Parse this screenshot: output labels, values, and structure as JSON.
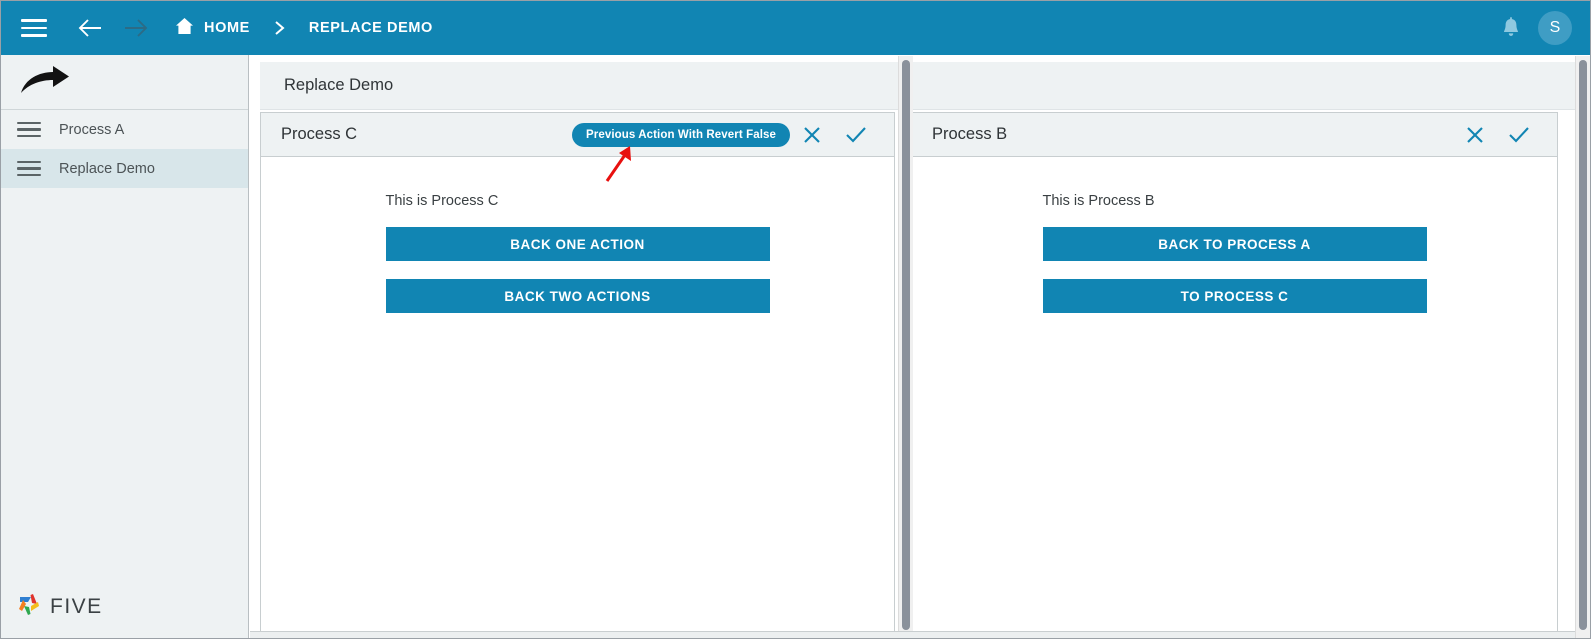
{
  "topbar": {
    "menu_icon": "hamburger-icon",
    "back_icon": "arrow-left-icon",
    "forward_icon": "arrow-right-icon",
    "home_icon": "home-icon",
    "home_label": "HOME",
    "separator": "chevron-right-icon",
    "breadcrumb_current": "REPLACE DEMO",
    "bell_icon": "bell-icon",
    "avatar_initial": "S",
    "background_color": "#1185b3"
  },
  "sidebar": {
    "logo_icon": "curved-arrow-icon",
    "items": [
      {
        "label": "Process A",
        "icon": "hamburger-icon",
        "selected": false
      },
      {
        "label": "Replace Demo",
        "icon": "hamburger-icon",
        "selected": true
      }
    ],
    "brand": {
      "name": "FIVE",
      "logo_icon": "five-pinwheel-logo"
    },
    "selected_color": "#d8e6ea"
  },
  "main": {
    "page_title": "Replace Demo",
    "panels": [
      {
        "title": "Process C",
        "badge": "Previous Action With Revert False",
        "close_icon": "close-icon",
        "confirm_icon": "check-icon",
        "body_text": "This is Process C",
        "buttons": [
          {
            "label": "BACK ONE ACTION"
          },
          {
            "label": "BACK TWO ACTIONS"
          }
        ]
      },
      {
        "title": "Process B",
        "badge": null,
        "close_icon": "close-icon",
        "confirm_icon": "check-icon",
        "body_text": "This is Process B",
        "buttons": [
          {
            "label": "BACK TO PROCESS A"
          },
          {
            "label": "TO PROCESS C"
          }
        ]
      }
    ],
    "accent_color": "#1185b3",
    "annotation": {
      "type": "arrow",
      "color": "#e8100f",
      "points_to": "Previous Action With Revert False"
    }
  }
}
